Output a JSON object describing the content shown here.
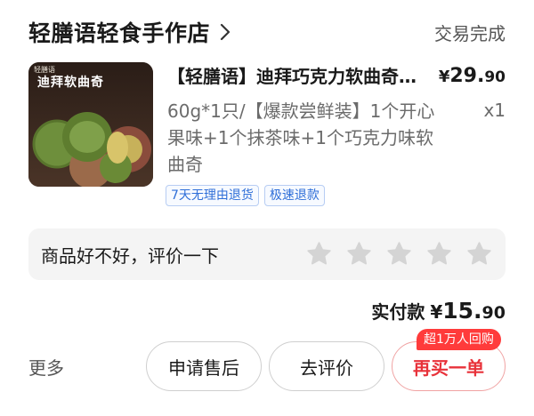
{
  "shop": {
    "name": "轻膳语轻食手作店",
    "status": "交易完成"
  },
  "product": {
    "image_label": "迪拜软曲奇",
    "brand_small": "轻膳语",
    "title": "【轻膳语】迪拜巧克力软曲奇…",
    "price_symbol": "¥",
    "price_int": "29.",
    "price_dec": "90",
    "spec": "60g*1只/【爆款尝鲜装】1个开心果味+1个抹茶味+1个巧克力味软曲奇",
    "qty": "x1",
    "tags": [
      "7天无理由退货",
      "极速退款"
    ]
  },
  "review": {
    "prompt": "商品好不好，评价一下",
    "stars": 5,
    "star_color": "#d4d4d4"
  },
  "payment": {
    "label": "实付款",
    "symbol": "¥",
    "int": "15.",
    "dec": "90"
  },
  "actions": {
    "more": "更多",
    "after_sale": "申请售后",
    "review": "去评价",
    "rebuy": "再买一单",
    "rebuy_badge": "超1万人回购"
  },
  "colors": {
    "accent_red": "#e8323a",
    "tag_blue": "#2f6fd8"
  }
}
